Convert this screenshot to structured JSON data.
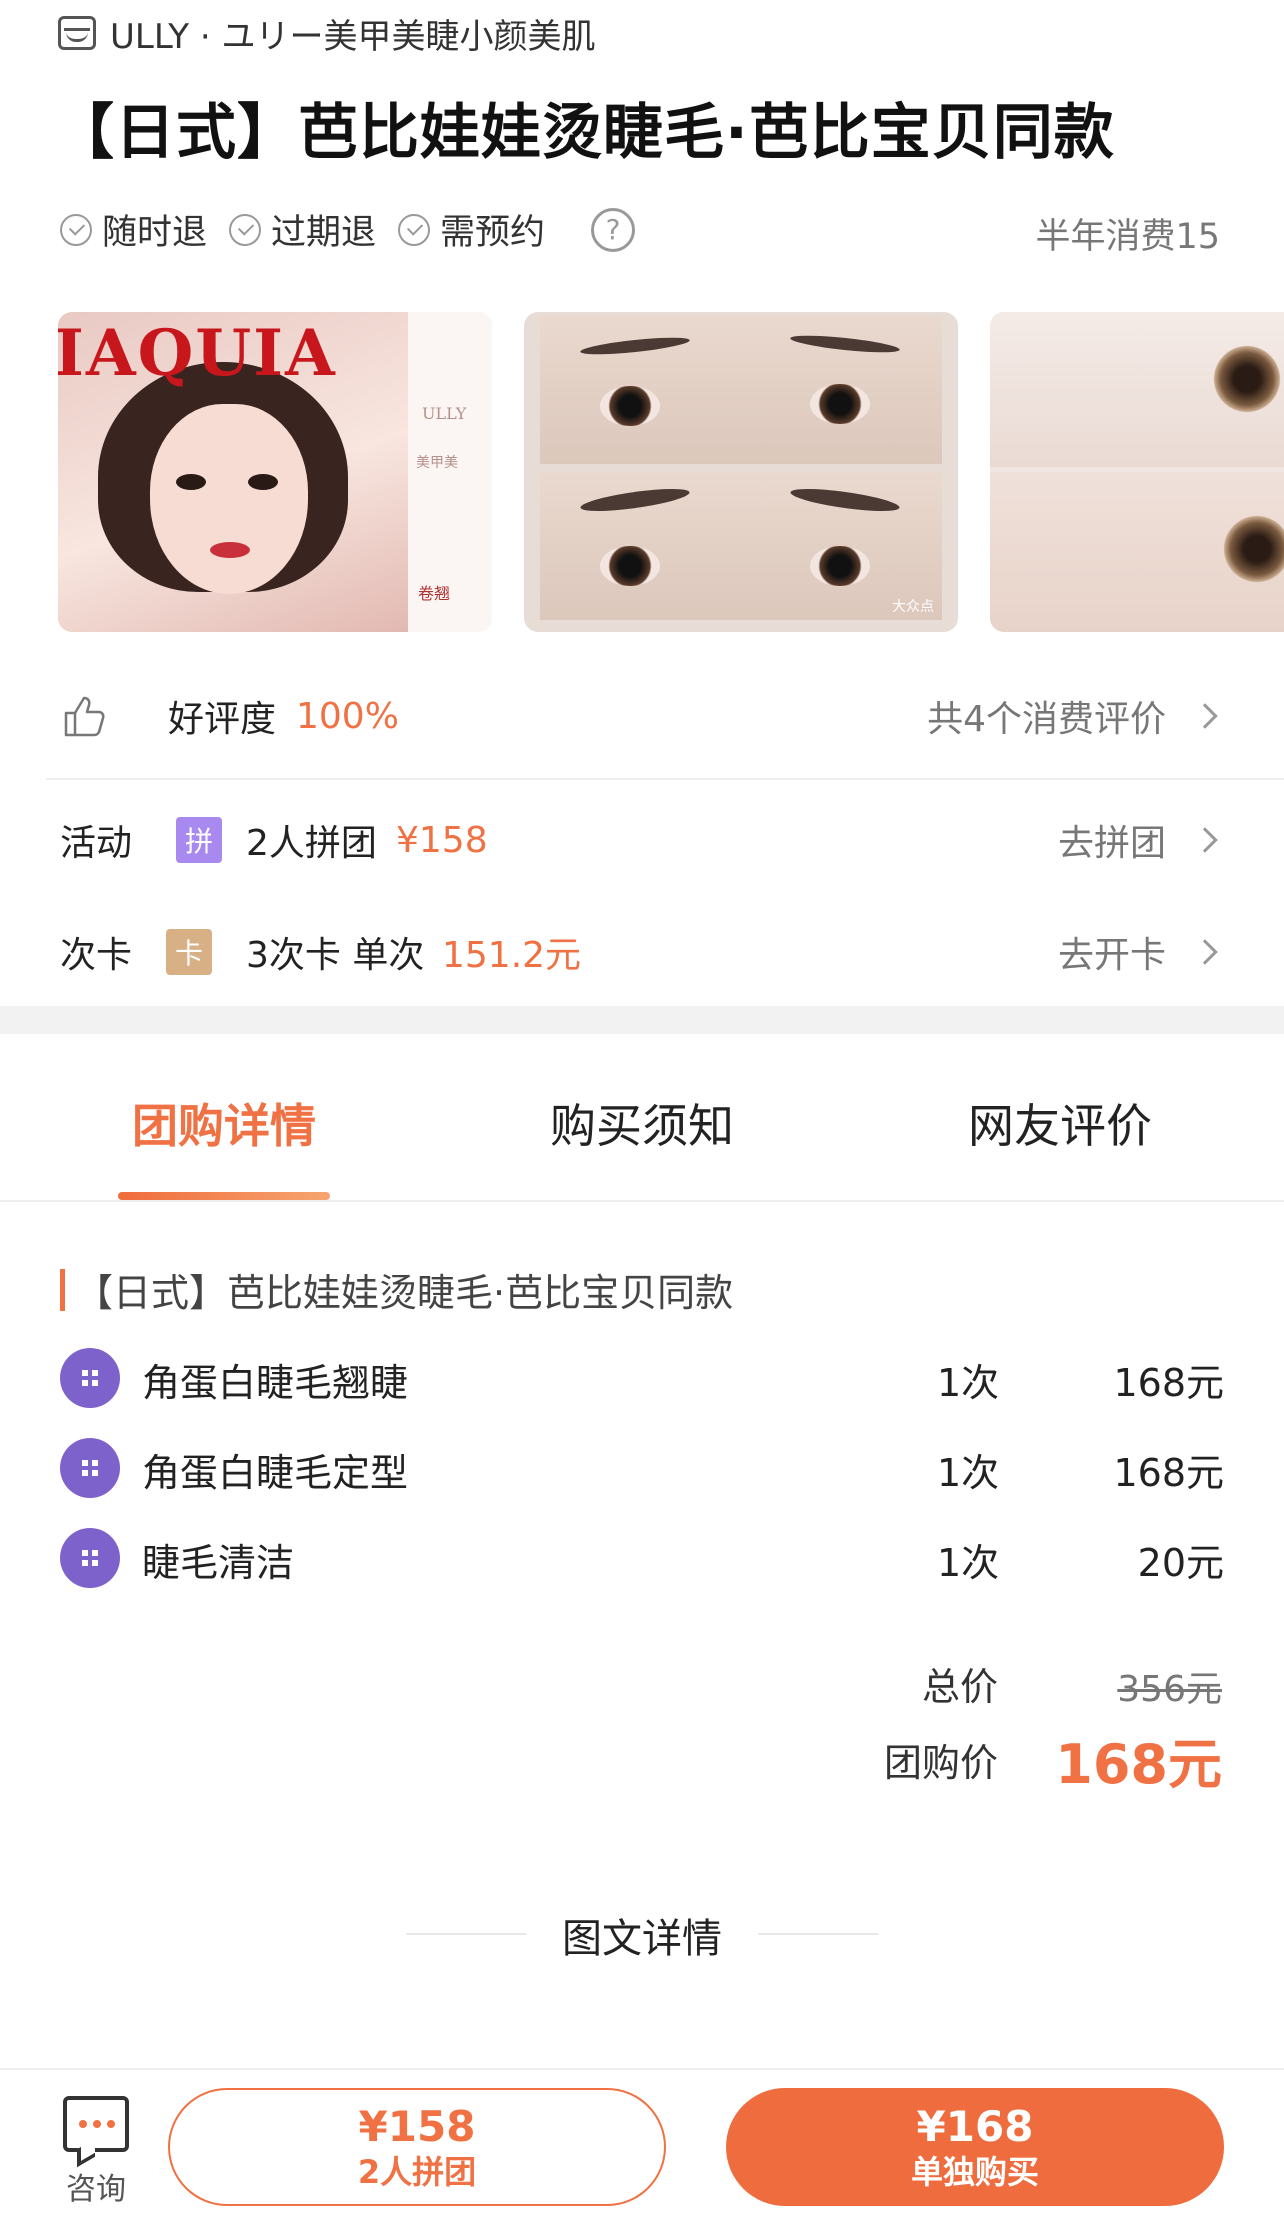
{
  "header": {
    "shop_name": "ULLY · ユリー美甲美睫小颜美肌",
    "title": "【日式】芭比娃娃烫睫毛·芭比宝贝同款",
    "tags": [
      "随时退",
      "过期退",
      "需预约"
    ],
    "sold": "半年消费15"
  },
  "images": {
    "magazine_title": "IAQUIA",
    "magazine_brand": "ULLY",
    "magazine_sub": "美甲美",
    "magazine_tag": "卷翘",
    "watermark": "大众点"
  },
  "rating": {
    "label": "好评度",
    "value": "100%",
    "reviews": "共4个消费评价"
  },
  "activity": {
    "label": "活动",
    "badge": "拼",
    "text": "2人拼团",
    "price": "¥158",
    "action": "去拼团"
  },
  "card": {
    "label": "次卡",
    "badge": "卡",
    "text": "3次卡 单次",
    "price": "151.2元",
    "action": "去开卡"
  },
  "tabs": [
    "团购详情",
    "购买须知",
    "网友评价"
  ],
  "detail": {
    "title": "【日式】芭比娃娃烫睫毛·芭比宝贝同款",
    "items": [
      {
        "name": "角蛋白睫毛翘睫",
        "qty": "1次",
        "price": "168元"
      },
      {
        "name": "角蛋白睫毛定型",
        "qty": "1次",
        "price": "168元"
      },
      {
        "name": "睫毛清洁",
        "qty": "1次",
        "price": "20元"
      }
    ],
    "total_label": "总价",
    "total_value": "356元",
    "group_label": "团购价",
    "group_value": "168元",
    "pic_detail": "图文详情"
  },
  "bottom": {
    "consult": "咨询",
    "group_price": "¥158",
    "group_label": "2人拼团",
    "buy_price": "¥168",
    "buy_label": "单独购买"
  },
  "colors": {
    "accent": "#f07143",
    "purple": "#7e62cb",
    "badge_pin": "#a889f0",
    "badge_ka": "#d8b086"
  }
}
